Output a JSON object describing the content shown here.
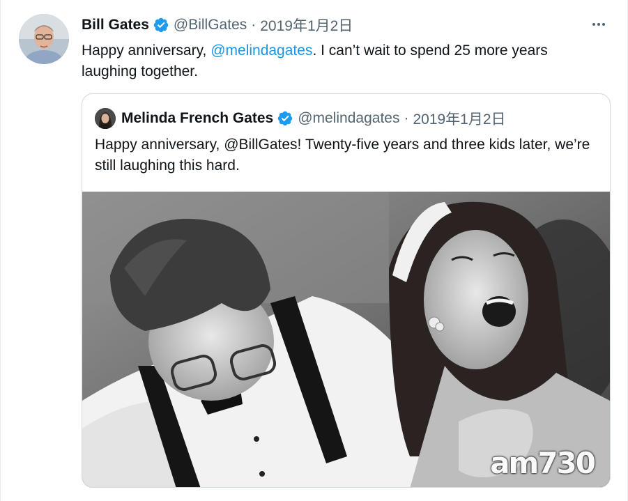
{
  "tweet": {
    "author": {
      "name": "Bill Gates",
      "handle": "@BillGates",
      "verified": true
    },
    "separator": "·",
    "date": "2019年1月2日",
    "text_before": "Happy anniversary, ",
    "mention": "@melindagates",
    "text_after": ". I can’t wait to spend 25 more years laughing together.",
    "more_icon": "more-horizontal-icon"
  },
  "quoted_tweet": {
    "author": {
      "name": "Melinda French Gates",
      "handle": "@melindagates",
      "verified": true
    },
    "separator": "·",
    "date": "2019年1月2日",
    "text": "Happy anniversary, @BillGates! Twenty-five years and three kids later, we’re still laughing this hard."
  },
  "watermark": "am730",
  "colors": {
    "link": "#1b95e0",
    "verified": "#1d9bf0",
    "secondary_text": "#536471",
    "border": "#cfd9de"
  }
}
